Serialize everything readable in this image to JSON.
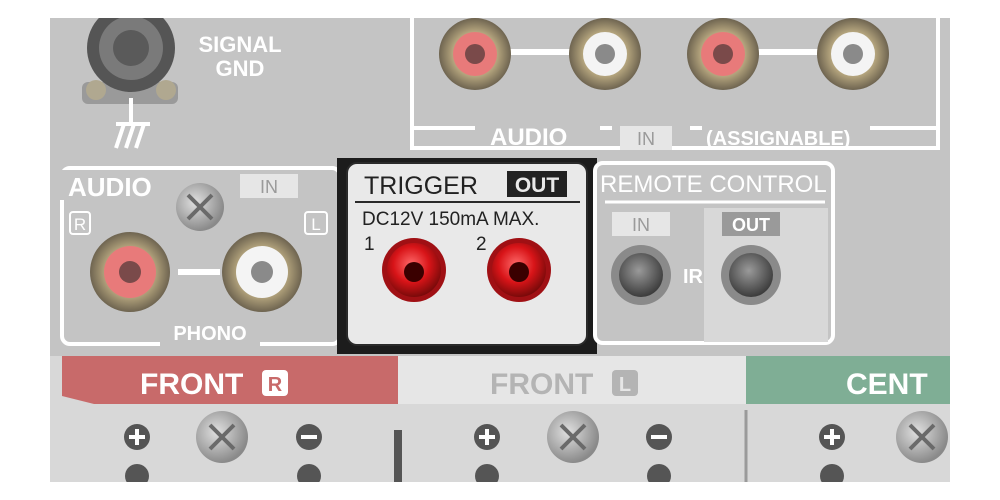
{
  "signal_gnd": {
    "label_line1": "SIGNAL",
    "label_line2": "GND"
  },
  "audio_in_assignable": {
    "title": "AUDIO",
    "badge": "IN",
    "note": "(ASSIGNABLE)"
  },
  "audio_phono": {
    "title": "AUDIO",
    "badge": "IN",
    "channel_right": "R",
    "channel_left": "L",
    "footer": "PHONO"
  },
  "trigger_out": {
    "title": "TRIGGER",
    "badge": "OUT",
    "rating": "DC12V 150mA MAX.",
    "jack1_number": "1",
    "jack2_number": "2"
  },
  "remote_control": {
    "title": "REMOTE CONTROL",
    "in_label": "IN",
    "out_label": "OUT",
    "ir_label": "IR"
  },
  "speakers": {
    "front_r": {
      "label": "FRONT",
      "badge": "R"
    },
    "front_l": {
      "label": "FRONT",
      "badge": "L"
    },
    "center": {
      "label": "CENT"
    }
  },
  "colors": {
    "panel_gray": "#c4c4c4",
    "panel_bright": "#e9e9e9",
    "trigger_jack_red": "#d81418",
    "front_r_band": "#c86a6a",
    "center_band": "#7fae95"
  }
}
